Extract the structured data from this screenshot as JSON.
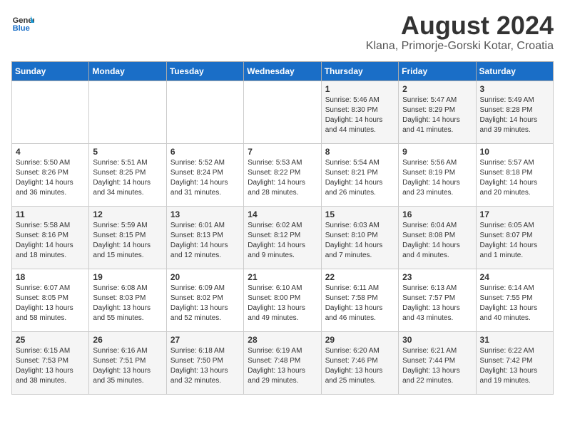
{
  "logo": {
    "general": "General",
    "blue": "Blue"
  },
  "title": "August 2024",
  "location": "Klana, Primorje-Gorski Kotar, Croatia",
  "days_header": [
    "Sunday",
    "Monday",
    "Tuesday",
    "Wednesday",
    "Thursday",
    "Friday",
    "Saturday"
  ],
  "weeks": [
    [
      {
        "day": "",
        "details": ""
      },
      {
        "day": "",
        "details": ""
      },
      {
        "day": "",
        "details": ""
      },
      {
        "day": "",
        "details": ""
      },
      {
        "day": "1",
        "details": "Sunrise: 5:46 AM\nSunset: 8:30 PM\nDaylight: 14 hours\nand 44 minutes."
      },
      {
        "day": "2",
        "details": "Sunrise: 5:47 AM\nSunset: 8:29 PM\nDaylight: 14 hours\nand 41 minutes."
      },
      {
        "day": "3",
        "details": "Sunrise: 5:49 AM\nSunset: 8:28 PM\nDaylight: 14 hours\nand 39 minutes."
      }
    ],
    [
      {
        "day": "4",
        "details": "Sunrise: 5:50 AM\nSunset: 8:26 PM\nDaylight: 14 hours\nand 36 minutes."
      },
      {
        "day": "5",
        "details": "Sunrise: 5:51 AM\nSunset: 8:25 PM\nDaylight: 14 hours\nand 34 minutes."
      },
      {
        "day": "6",
        "details": "Sunrise: 5:52 AM\nSunset: 8:24 PM\nDaylight: 14 hours\nand 31 minutes."
      },
      {
        "day": "7",
        "details": "Sunrise: 5:53 AM\nSunset: 8:22 PM\nDaylight: 14 hours\nand 28 minutes."
      },
      {
        "day": "8",
        "details": "Sunrise: 5:54 AM\nSunset: 8:21 PM\nDaylight: 14 hours\nand 26 minutes."
      },
      {
        "day": "9",
        "details": "Sunrise: 5:56 AM\nSunset: 8:19 PM\nDaylight: 14 hours\nand 23 minutes."
      },
      {
        "day": "10",
        "details": "Sunrise: 5:57 AM\nSunset: 8:18 PM\nDaylight: 14 hours\nand 20 minutes."
      }
    ],
    [
      {
        "day": "11",
        "details": "Sunrise: 5:58 AM\nSunset: 8:16 PM\nDaylight: 14 hours\nand 18 minutes."
      },
      {
        "day": "12",
        "details": "Sunrise: 5:59 AM\nSunset: 8:15 PM\nDaylight: 14 hours\nand 15 minutes."
      },
      {
        "day": "13",
        "details": "Sunrise: 6:01 AM\nSunset: 8:13 PM\nDaylight: 14 hours\nand 12 minutes."
      },
      {
        "day": "14",
        "details": "Sunrise: 6:02 AM\nSunset: 8:12 PM\nDaylight: 14 hours\nand 9 minutes."
      },
      {
        "day": "15",
        "details": "Sunrise: 6:03 AM\nSunset: 8:10 PM\nDaylight: 14 hours\nand 7 minutes."
      },
      {
        "day": "16",
        "details": "Sunrise: 6:04 AM\nSunset: 8:08 PM\nDaylight: 14 hours\nand 4 minutes."
      },
      {
        "day": "17",
        "details": "Sunrise: 6:05 AM\nSunset: 8:07 PM\nDaylight: 14 hours\nand 1 minute."
      }
    ],
    [
      {
        "day": "18",
        "details": "Sunrise: 6:07 AM\nSunset: 8:05 PM\nDaylight: 13 hours\nand 58 minutes."
      },
      {
        "day": "19",
        "details": "Sunrise: 6:08 AM\nSunset: 8:03 PM\nDaylight: 13 hours\nand 55 minutes."
      },
      {
        "day": "20",
        "details": "Sunrise: 6:09 AM\nSunset: 8:02 PM\nDaylight: 13 hours\nand 52 minutes."
      },
      {
        "day": "21",
        "details": "Sunrise: 6:10 AM\nSunset: 8:00 PM\nDaylight: 13 hours\nand 49 minutes."
      },
      {
        "day": "22",
        "details": "Sunrise: 6:11 AM\nSunset: 7:58 PM\nDaylight: 13 hours\nand 46 minutes."
      },
      {
        "day": "23",
        "details": "Sunrise: 6:13 AM\nSunset: 7:57 PM\nDaylight: 13 hours\nand 43 minutes."
      },
      {
        "day": "24",
        "details": "Sunrise: 6:14 AM\nSunset: 7:55 PM\nDaylight: 13 hours\nand 40 minutes."
      }
    ],
    [
      {
        "day": "25",
        "details": "Sunrise: 6:15 AM\nSunset: 7:53 PM\nDaylight: 13 hours\nand 38 minutes."
      },
      {
        "day": "26",
        "details": "Sunrise: 6:16 AM\nSunset: 7:51 PM\nDaylight: 13 hours\nand 35 minutes."
      },
      {
        "day": "27",
        "details": "Sunrise: 6:18 AM\nSunset: 7:50 PM\nDaylight: 13 hours\nand 32 minutes."
      },
      {
        "day": "28",
        "details": "Sunrise: 6:19 AM\nSunset: 7:48 PM\nDaylight: 13 hours\nand 29 minutes."
      },
      {
        "day": "29",
        "details": "Sunrise: 6:20 AM\nSunset: 7:46 PM\nDaylight: 13 hours\nand 25 minutes."
      },
      {
        "day": "30",
        "details": "Sunrise: 6:21 AM\nSunset: 7:44 PM\nDaylight: 13 hours\nand 22 minutes."
      },
      {
        "day": "31",
        "details": "Sunrise: 6:22 AM\nSunset: 7:42 PM\nDaylight: 13 hours\nand 19 minutes."
      }
    ]
  ]
}
